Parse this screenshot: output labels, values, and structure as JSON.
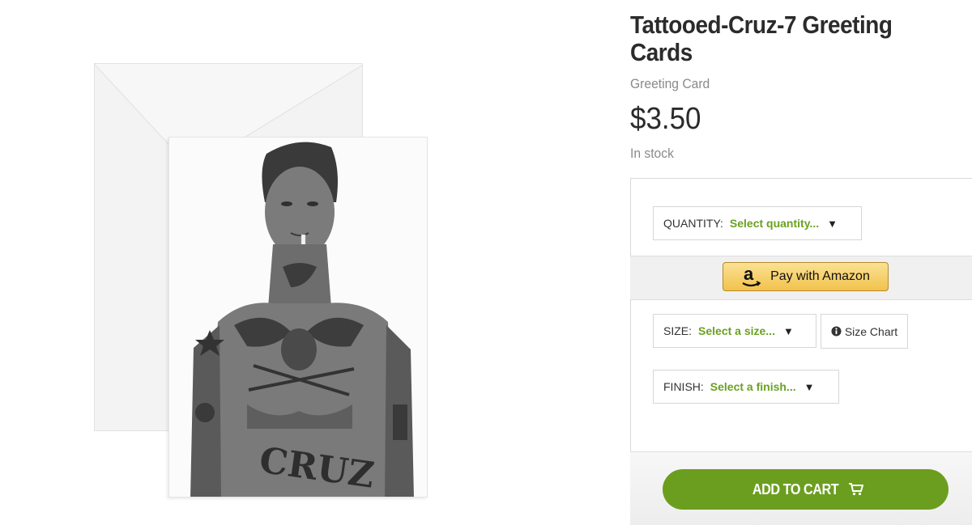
{
  "product": {
    "title": "Tattooed-Cruz-7 Greeting Cards",
    "type": "Greeting Card",
    "price": "$3.50",
    "stock_status": "In stock"
  },
  "options": {
    "quantity": {
      "label": "QUANTITY:",
      "value": "Select quantity...",
      "arrow": "▼"
    },
    "size": {
      "label": "SIZE:",
      "value": "Select a size...",
      "arrow": "▼"
    },
    "finish": {
      "label": "FINISH:",
      "value": "Select a finish...",
      "arrow": "▼"
    },
    "size_chart_label": "Size Chart"
  },
  "amazon": {
    "button_label": "Pay with Amazon",
    "logo_letter": "a"
  },
  "cart": {
    "button_label": "ADD TO CART"
  },
  "icons": {
    "amazon": "amazon-logo-icon",
    "info": "info-icon",
    "cart": "shopping-cart-icon",
    "dropdown": "chevron-down-icon"
  },
  "colors": {
    "accent_green": "#6aa121",
    "cart_button": "#6b9e1f",
    "amazon_button": "#f2c24d",
    "title_text": "#2b2b2b",
    "muted_text": "#8a8a8a"
  }
}
